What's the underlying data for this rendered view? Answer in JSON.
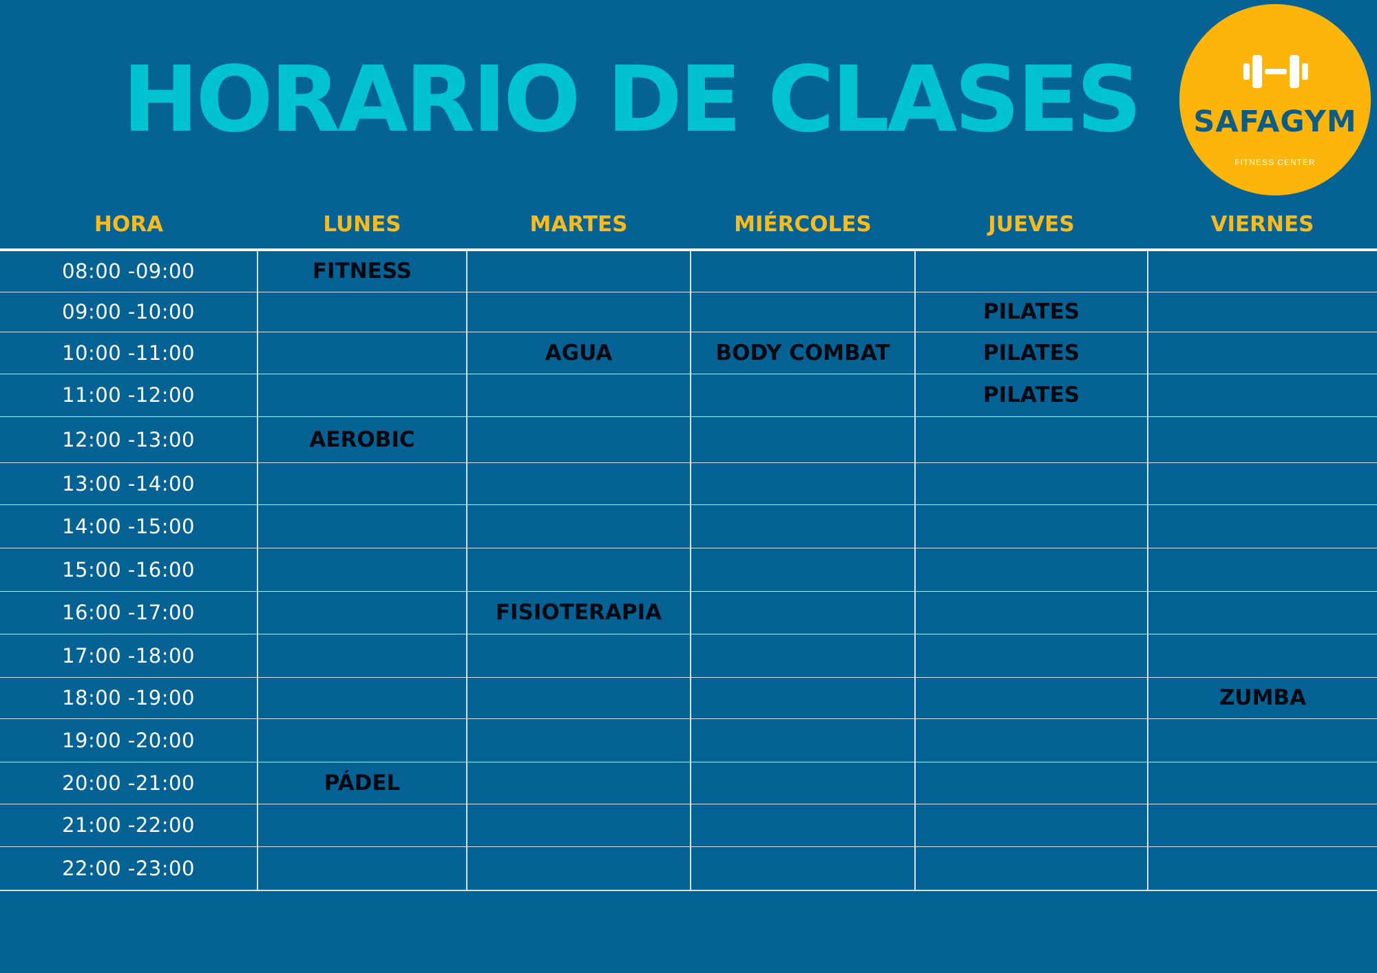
{
  "title": "HORARIO DE CLASES",
  "logo": {
    "icon": "dumbbell-icon",
    "name": "SAFAGYM",
    "subtitle": "FITNESS CENTER",
    "background_color": "#fdb40b",
    "text_color": "#0b5d86"
  },
  "colors": {
    "background": "#046394",
    "title": "#00c2d1",
    "header": "#fcbb1d",
    "class_text": "#050a12",
    "time_text": "#ffffff",
    "grid": "#d8e4ec"
  },
  "schedule": {
    "headers": [
      "HORA",
      "LUNES",
      "MARTES",
      "MIÉRCOLES",
      "JUEVES",
      "VIERNES"
    ],
    "rows": [
      [
        "08:00 -09:00",
        "FITNESS",
        "",
        "",
        "",
        ""
      ],
      [
        "09:00 -10:00",
        "",
        "",
        "",
        "PILATES",
        ""
      ],
      [
        "10:00 -11:00",
        "",
        "AGUA",
        "BODY COMBAT",
        "PILATES",
        ""
      ],
      [
        "11:00 -12:00",
        "",
        "",
        "",
        "PILATES",
        ""
      ],
      [
        "12:00 -13:00",
        "AEROBIC",
        "",
        "",
        "",
        ""
      ],
      [
        "13:00 -14:00",
        "",
        "",
        "",
        "",
        ""
      ],
      [
        "14:00 -15:00",
        "",
        "",
        "",
        "",
        ""
      ],
      [
        "15:00 -16:00",
        "",
        "",
        "",
        "",
        ""
      ],
      [
        "16:00 -17:00",
        "",
        "FISIOTERAPIA",
        "",
        "",
        ""
      ],
      [
        "17:00 -18:00",
        "",
        "",
        "",
        "",
        ""
      ],
      [
        "18:00 -19:00",
        "",
        "",
        "",
        "",
        "ZUMBA"
      ],
      [
        "19:00 -20:00",
        "",
        "",
        "",
        "",
        ""
      ],
      [
        "20:00 -21:00",
        "PÁDEL",
        "",
        "",
        "",
        ""
      ],
      [
        "21:00 -22:00",
        "",
        "",
        "",
        "",
        ""
      ],
      [
        "22:00 -23:00",
        "",
        "",
        "",
        "",
        ""
      ]
    ]
  }
}
